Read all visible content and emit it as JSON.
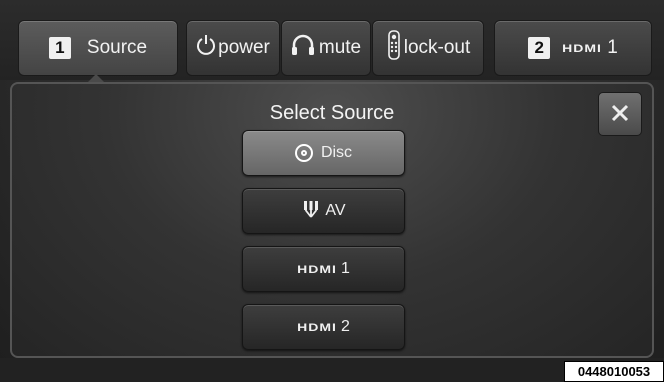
{
  "topbar": {
    "zone1": {
      "number": "1",
      "label": "Source"
    },
    "power": {
      "label": "power",
      "icon": "power-icon"
    },
    "mute": {
      "label": "mute",
      "icon": "headphones-icon"
    },
    "lockout": {
      "label": "lock-out",
      "icon": "remote-icon"
    },
    "zone2": {
      "number": "2",
      "logo": "HDMI",
      "suffix": "1"
    }
  },
  "panel": {
    "title": "Select Source",
    "close_icon": "close-icon",
    "sources": [
      {
        "label": "Disc",
        "icon": "disc-icon",
        "selected": true
      },
      {
        "label": "AV",
        "icon": "av-cable-icon",
        "selected": false
      },
      {
        "logo": "HDMI",
        "label": "1",
        "selected": false
      },
      {
        "logo": "HDMI",
        "label": "2",
        "selected": false
      }
    ]
  },
  "caption": "0448010053",
  "colors": {
    "selected": "#7a7a7a",
    "button": "#333333",
    "background": "#2a2a2a"
  }
}
